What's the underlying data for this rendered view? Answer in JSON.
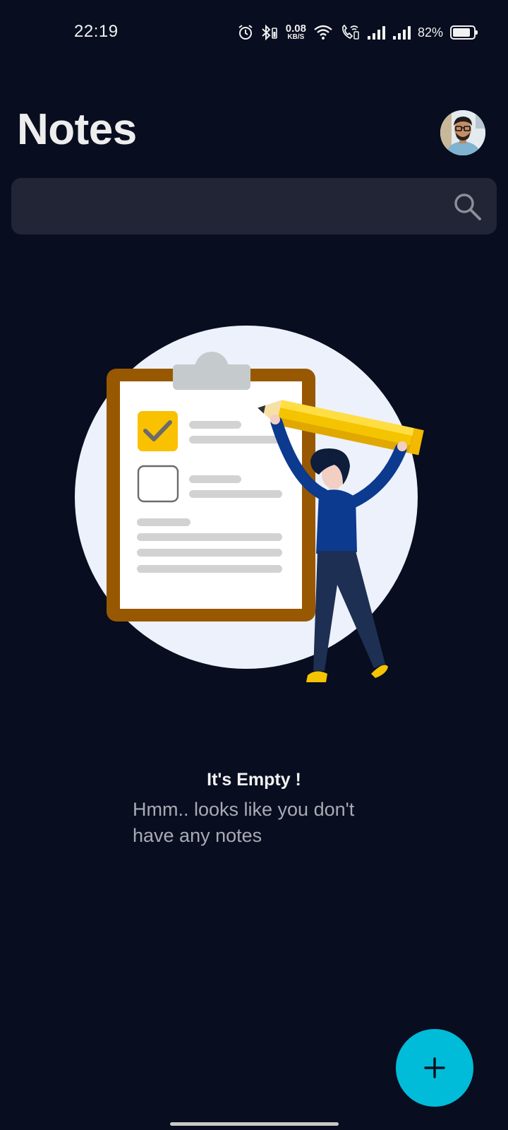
{
  "status_bar": {
    "time": "22:19",
    "net_speed_value": "0.08",
    "net_speed_unit": "KB/S",
    "battery_percent": "82%",
    "battery_level": 0.82,
    "icons": [
      "alarm-icon",
      "bluetooth-icon",
      "wifi-icon",
      "wifi-calling-icon",
      "signal-1-icon",
      "signal-2-icon",
      "battery-icon"
    ]
  },
  "header": {
    "title": "Notes",
    "avatar_icon": "profile-avatar"
  },
  "search": {
    "placeholder": "",
    "value": "",
    "icon": "search-icon"
  },
  "empty_state": {
    "title": "It's Empty !",
    "subtitle": "Hmm.. looks like you don't have any notes",
    "illustration": "clipboard-checklist-person-with-pencil"
  },
  "fab": {
    "icon": "plus-icon",
    "color": "#00bcd8"
  },
  "colors": {
    "background": "#080d1f",
    "search_bg": "#222536",
    "accent": "#00bcd8"
  }
}
